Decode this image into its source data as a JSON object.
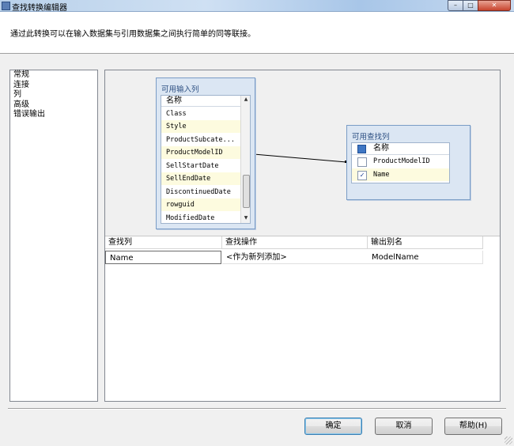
{
  "window": {
    "title": "查找转换编辑器",
    "min_glyph": "–",
    "max_glyph": "□",
    "close_glyph": "✕"
  },
  "header": {
    "description": "通过此转换可以在输入数据集与引用数据集之间执行简单的同等联接。"
  },
  "nav": {
    "items": [
      {
        "label": "常规"
      },
      {
        "label": "连接"
      },
      {
        "label": "列"
      },
      {
        "label": "高级"
      },
      {
        "label": "错误输出"
      }
    ]
  },
  "input_table": {
    "title": "可用输入列",
    "column_header": "名称",
    "rows": [
      {
        "label": "Class"
      },
      {
        "label": "Style"
      },
      {
        "label": "ProductSubcate..."
      },
      {
        "label": "ProductModelID"
      },
      {
        "label": "SellStartDate"
      },
      {
        "label": "SellEndDate"
      },
      {
        "label": "DiscontinuedDate"
      },
      {
        "label": "rowguid"
      },
      {
        "label": "ModifiedDate"
      }
    ],
    "scroll_up_glyph": "▲",
    "scroll_down_glyph": "▼"
  },
  "lookup_table": {
    "title": "可用查找列",
    "column_header": "名称",
    "rows": [
      {
        "label": "ProductModelID",
        "checked": false
      },
      {
        "label": "Name",
        "checked": true
      }
    ],
    "check_glyph": "✓"
  },
  "grid": {
    "headers": [
      "查找列",
      "查找操作",
      "输出别名"
    ],
    "rows": [
      {
        "lookup_column": "Name",
        "operation": "<作为新列添加>",
        "alias": "ModelName"
      }
    ]
  },
  "buttons": {
    "ok": "确定",
    "cancel": "取消",
    "help": "帮助(H)"
  },
  "colors": {
    "table_box_bg": "#dbe6f3",
    "table_title": "#2a4d80",
    "highlight_row": "#fdfbdf",
    "default_button_border": "#3c7fb1"
  }
}
